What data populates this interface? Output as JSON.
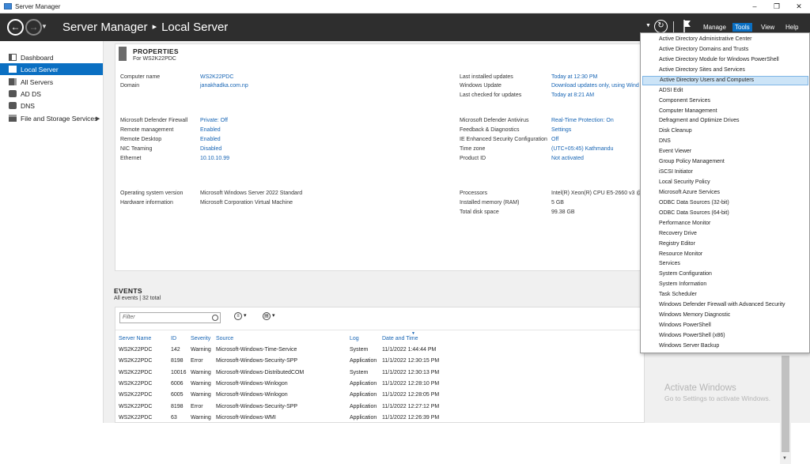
{
  "window": {
    "title": "Server Manager",
    "controls": [
      "–",
      "❐",
      "✕"
    ]
  },
  "header": {
    "breadcrumb_root": "Server Manager",
    "breadcrumb_sep": "▸",
    "breadcrumb_current": "Local Server",
    "menus": {
      "manage": "Manage",
      "tools": "Tools",
      "view": "View",
      "help": "Help"
    }
  },
  "sidebar": {
    "items": [
      {
        "label": "Dashboard",
        "icon": "dashboard-icon"
      },
      {
        "label": "Local Server",
        "icon": "server-icon"
      },
      {
        "label": "All Servers",
        "icon": "servers-icon"
      },
      {
        "label": "AD DS",
        "icon": "ad-ds-icon"
      },
      {
        "label": "DNS",
        "icon": "dns-icon"
      },
      {
        "label": "File and Storage Services",
        "icon": "storage-icon"
      }
    ],
    "expand_arrow": "▶"
  },
  "properties": {
    "title": "PROPERTIES",
    "subtitle": "For WS2K22PDC",
    "left": [
      {
        "label": "Computer name",
        "value": "WS2K22PDC",
        "link": true
      },
      {
        "label": "Domain",
        "value": "janakhadka.com.np",
        "link": true
      },
      {
        "label": "Microsoft Defender Firewall",
        "value": "Private: Off",
        "link": true
      },
      {
        "label": "Remote management",
        "value": "Enabled",
        "link": true
      },
      {
        "label": "Remote Desktop",
        "value": "Enabled",
        "link": true
      },
      {
        "label": "NIC Teaming",
        "value": "Disabled",
        "link": true
      },
      {
        "label": "Ethernet",
        "value": "10.10.10.99",
        "link": true
      },
      {
        "label": "Operating system version",
        "value": "Microsoft Windows Server 2022 Standard",
        "link": false
      },
      {
        "label": "Hardware information",
        "value": "Microsoft Corporation Virtual Machine",
        "link": false
      }
    ],
    "right": [
      {
        "label": "Last installed updates",
        "value": "Today at 12:30 PM",
        "link": true
      },
      {
        "label": "Windows Update",
        "value": "Download updates only, using Wind",
        "link": true
      },
      {
        "label": "Last checked for updates",
        "value": "Today at 8:21 AM",
        "link": true
      },
      {
        "label": "Microsoft Defender Antivirus",
        "value": "Real-Time Protection: On",
        "link": true
      },
      {
        "label": "Feedback & Diagnostics",
        "value": "Settings",
        "link": true
      },
      {
        "label": "IE Enhanced Security Configuration",
        "value": "Off",
        "link": true
      },
      {
        "label": "Time zone",
        "value": "(UTC+05:45) Kathmandu",
        "link": true
      },
      {
        "label": "Product ID",
        "value": "Not activated",
        "link": true
      },
      {
        "label": "Processors",
        "value": "Intel(R) Xeon(R) CPU E5-2660 v3 @ 2",
        "link": false
      },
      {
        "label": "Installed memory (RAM)",
        "value": "5 GB",
        "link": false
      },
      {
        "label": "Total disk space",
        "value": "99.38 GB",
        "link": false
      }
    ]
  },
  "events": {
    "title": "EVENTS",
    "subtitle": "All events | 32 total",
    "filter_placeholder": "Filter",
    "columns": [
      "Server Name",
      "ID",
      "Severity",
      "Source",
      "Log",
      "Date and Time"
    ],
    "rows": [
      [
        "WS2K22PDC",
        "142",
        "Warning",
        "Microsoft-Windows-Time-Service",
        "System",
        "11/1/2022 1:44:44 PM"
      ],
      [
        "WS2K22PDC",
        "8198",
        "Error",
        "Microsoft-Windows-Security-SPP",
        "Application",
        "11/1/2022 12:30:15 PM"
      ],
      [
        "WS2K22PDC",
        "10016",
        "Warning",
        "Microsoft-Windows-DistributedCOM",
        "System",
        "11/1/2022 12:30:13 PM"
      ],
      [
        "WS2K22PDC",
        "6006",
        "Warning",
        "Microsoft-Windows-Winlogon",
        "Application",
        "11/1/2022 12:28:10 PM"
      ],
      [
        "WS2K22PDC",
        "6005",
        "Warning",
        "Microsoft-Windows-Winlogon",
        "Application",
        "11/1/2022 12:28:05 PM"
      ],
      [
        "WS2K22PDC",
        "8198",
        "Error",
        "Microsoft-Windows-Security-SPP",
        "Application",
        "11/1/2022 12:27:12 PM"
      ],
      [
        "WS2K22PDC",
        "63",
        "Warning",
        "Microsoft-Windows-WMI",
        "Application",
        "11/1/2022 12:26:39 PM"
      ]
    ]
  },
  "tools_menu": {
    "items": [
      "Active Directory Administrative Center",
      "Active Directory Domains and Trusts",
      "Active Directory Module for Windows PowerShell",
      "Active Directory Sites and Services",
      "Active Directory Users and Computers",
      "ADSI Edit",
      "Component Services",
      "Computer Management",
      "Defragment and Optimize Drives",
      "Disk Cleanup",
      "DNS",
      "Event Viewer",
      "Group Policy Management",
      "iSCSI Initiator",
      "Local Security Policy",
      "Microsoft Azure Services",
      "ODBC Data Sources (32-bit)",
      "ODBC Data Sources (64-bit)",
      "Performance Monitor",
      "Recovery Drive",
      "Registry Editor",
      "Resource Monitor",
      "Services",
      "System Configuration",
      "System Information",
      "Task Scheduler",
      "Windows Defender Firewall with Advanced Security",
      "Windows Memory Diagnostic",
      "Windows PowerShell",
      "Windows PowerShell (x86)",
      "Windows Server Backup"
    ],
    "highlighted": "Active Directory Users and Computers"
  },
  "watermark": {
    "line1": "Activate Windows",
    "line2": "Go to Settings to activate Windows."
  },
  "colors": {
    "header_bg": "#2e2e2e",
    "accent": "#0a6fc2",
    "link": "#1664b4",
    "highlight": "#cce4f7"
  }
}
